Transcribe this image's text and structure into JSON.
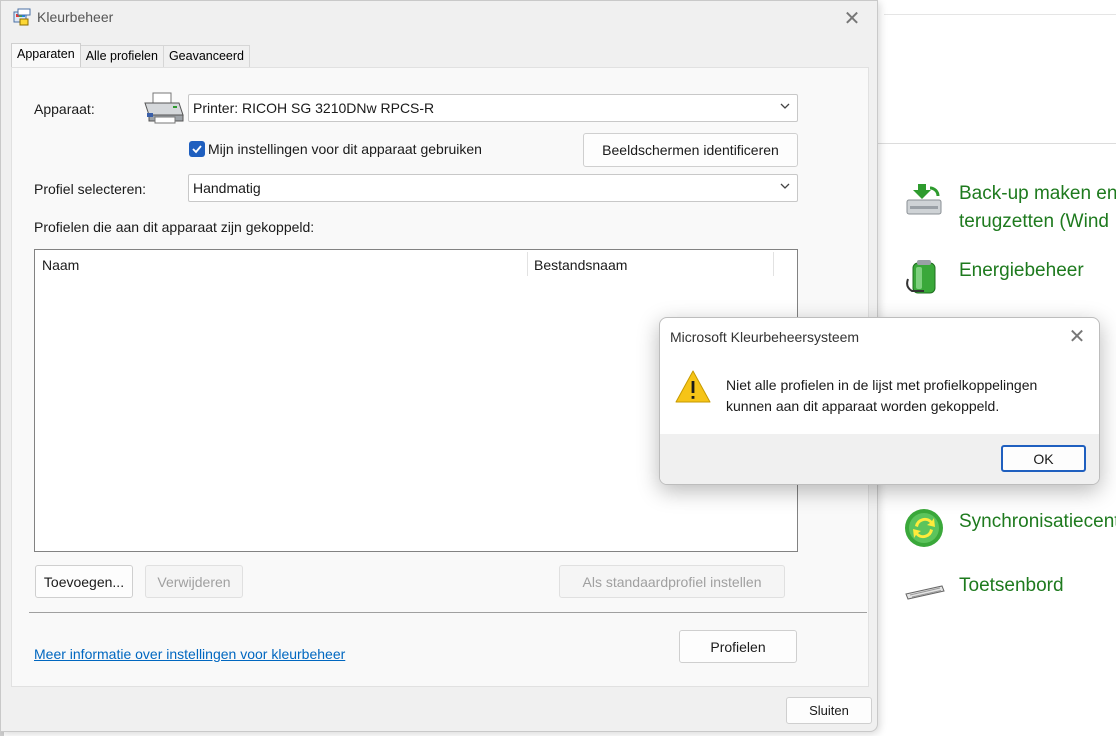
{
  "window": {
    "title": "Kleurbeheer",
    "tabs": [
      "Apparaten",
      "Alle profielen",
      "Geavanceerd"
    ],
    "active_tab": "Apparaten"
  },
  "devices": {
    "device_label": "Apparaat:",
    "device_value": "Printer: RICOH SG 3210DNw RPCS-R",
    "use_settings_label": "Mijn instellingen voor dit apparaat gebruiken",
    "use_settings_checked": true,
    "identify_button": "Beeldschermen identificeren",
    "profile_select_label": "Profiel selecteren:",
    "profile_select_value": "Handmatig",
    "associated_label": "Profielen die aan dit apparaat zijn gekoppeld:",
    "columns": [
      "Naam",
      "Bestandsnaam"
    ],
    "rows": [],
    "add_button": "Toevoegen...",
    "remove_button": "Verwijderen",
    "default_button": "Als standaardprofiel instellen",
    "help_link": "Meer informatie over instellingen voor kleurbeheer",
    "profiles_button": "Profielen"
  },
  "footer": {
    "close_button": "Sluiten"
  },
  "dialog": {
    "title": "Microsoft Kleurbeheersysteem",
    "message_line1": "Niet alle profielen in de lijst met profielkoppelingen",
    "message_line2": "kunnen aan dit apparaat worden gekoppeld.",
    "ok_button": "OK",
    "icon": "warning-icon"
  },
  "background": {
    "items": [
      {
        "label": "Back-up maken en\nterugzetten (Wind",
        "icon": "backup-icon"
      },
      {
        "label": "Energiebeheer",
        "icon": "battery-icon"
      },
      {
        "label": "Synchronisatiecent",
        "icon": "sync-icon"
      },
      {
        "label": "Toetsenbord",
        "icon": "keyboard-icon"
      }
    ]
  },
  "colors": {
    "accent": "#1f5fbf",
    "link": "#0067c0",
    "control_panel_text": "#1e7a1e",
    "warning": "#f6c417"
  }
}
